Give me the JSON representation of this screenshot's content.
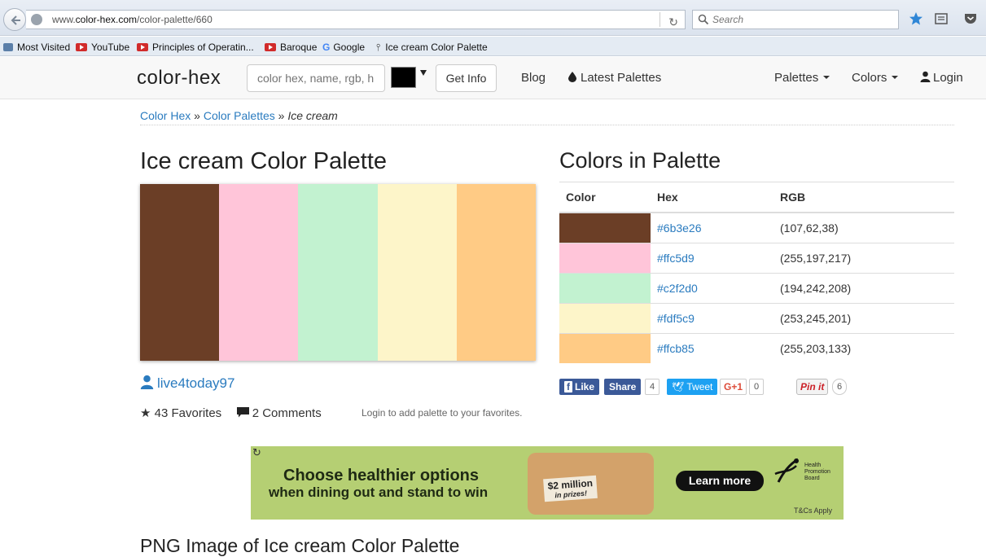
{
  "browser": {
    "url_prefix": "www.",
    "url_domain": "color-hex.com",
    "url_path": "/color-palette/660",
    "search_placeholder": "Search"
  },
  "bookmarks": [
    {
      "label": "Most Visited",
      "icon": "bookmark-icon"
    },
    {
      "label": "YouTube",
      "icon": "youtube-icon"
    },
    {
      "label": "Principles of Operatin...",
      "icon": "youtube-icon"
    },
    {
      "label": "Baroque",
      "icon": "youtube-icon"
    },
    {
      "label": "Google",
      "icon": "google-icon"
    },
    {
      "label": "Ice cream Color Palette",
      "icon": "ice-cream-icon"
    }
  ],
  "nav": {
    "brand": "color-hex",
    "search_placeholder": "color hex, name, rgb, h",
    "get_info": "Get Info",
    "blog": "Blog",
    "latest": "Latest Palettes",
    "palettes": "Palettes",
    "colors": "Colors",
    "login": "Login"
  },
  "breadcrumb": {
    "home": "Color Hex",
    "sep": "»",
    "section": "Color Palettes",
    "current": "Ice cream"
  },
  "palette": {
    "title": "Ice cream Color Palette",
    "author": "live4today97",
    "favorites": "43 Favorites",
    "comments": "2 Comments",
    "login_note": "Login to add palette to your favorites.",
    "colors": [
      "#6b3e26",
      "#ffc5d9",
      "#c2f2d0",
      "#fdf5c9",
      "#ffcb85"
    ]
  },
  "colors_table": {
    "title": "Colors in Palette",
    "headers": [
      "Color",
      "Hex",
      "RGB"
    ],
    "rows": [
      {
        "hex": "#6b3e26",
        "rgb": "(107,62,38)"
      },
      {
        "hex": "#ffc5d9",
        "rgb": "(255,197,217)"
      },
      {
        "hex": "#c2f2d0",
        "rgb": "(194,242,208)"
      },
      {
        "hex": "#fdf5c9",
        "rgb": "(253,245,201)"
      },
      {
        "hex": "#ffcb85",
        "rgb": "(255,203,133)"
      }
    ]
  },
  "share": {
    "like": "Like",
    "share": "Share",
    "share_count": "4",
    "tweet": "Tweet",
    "gplus": "G+1",
    "gplus_count": "0",
    "pin": "Pin it",
    "pin_count": "6"
  },
  "ad": {
    "line1": "Choose healthier options",
    "line2": "when dining out and stand to win",
    "prize": "$2 million",
    "prize_sub": "in prizes!",
    "cta": "Learn more",
    "sponsor": "Health Promotion Board",
    "tc": "T&Cs Apply"
  },
  "png_title": "PNG Image of Ice cream Color Palette"
}
